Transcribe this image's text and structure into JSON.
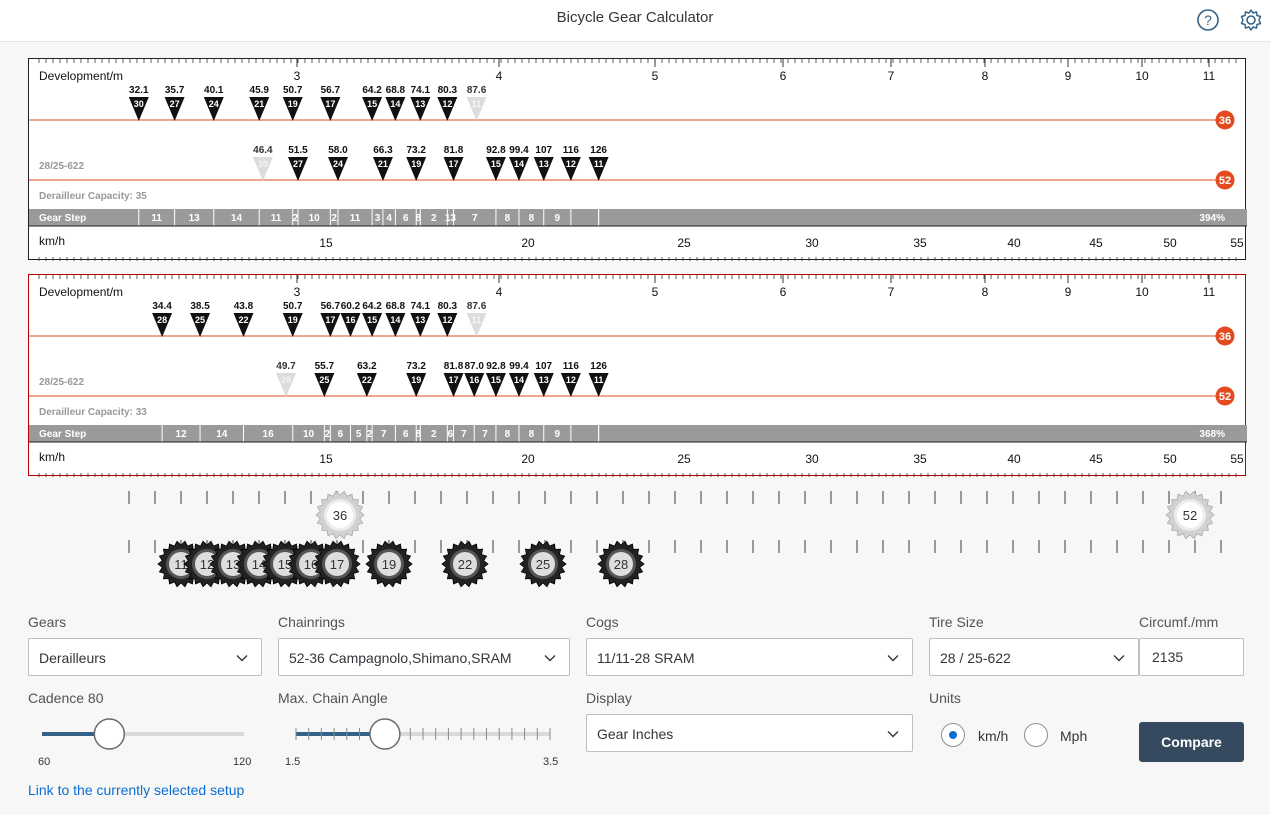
{
  "app": {
    "title": "Bicycle Gear Calculator"
  },
  "header": {
    "help_icon": "help-icon",
    "settings_icon": "gear-settings-icon"
  },
  "panels": [
    {
      "dev_label": "Development/m",
      "dev_ticks": [
        "3",
        "4",
        "5",
        "6",
        "7",
        "8",
        "9",
        "10",
        "11"
      ],
      "tire_label": "28/25-622",
      "capacity_label": "Derailleur Capacity: 35",
      "gear_step_label": "Gear Step",
      "kmh_label": "km/h",
      "speed_ticks": [
        "15",
        "20",
        "25",
        "30",
        "35",
        "40",
        "45",
        "50",
        "55"
      ],
      "chainrings": [
        {
          "teeth": "36",
          "color": "#e34a1d",
          "gears": [
            {
              "value": "32.1",
              "cog": "30",
              "active": true
            },
            {
              "value": "35.7",
              "cog": "27",
              "active": true
            },
            {
              "value": "40.1",
              "cog": "24",
              "active": true
            },
            {
              "value": "45.9",
              "cog": "21",
              "active": true
            },
            {
              "value": "50.7",
              "cog": "19",
              "active": true
            },
            {
              "value": "56.7",
              "cog": "17",
              "active": true
            },
            {
              "value": "64.2",
              "cog": "15",
              "active": true
            },
            {
              "value": "68.8",
              "cog": "14",
              "active": true
            },
            {
              "value": "74.1",
              "cog": "13",
              "active": true
            },
            {
              "value": "80.3",
              "cog": "12",
              "active": true
            },
            {
              "value": "87.6",
              "cog": "11",
              "active": false
            }
          ]
        },
        {
          "teeth": "52",
          "color": "#e34a1d",
          "gears": [
            {
              "value": "46.4",
              "cog": "30",
              "active": false
            },
            {
              "value": "51.5",
              "cog": "27",
              "active": true
            },
            {
              "value": "58.0",
              "cog": "24",
              "active": true
            },
            {
              "value": "66.3",
              "cog": "21",
              "active": true
            },
            {
              "value": "73.2",
              "cog": "19",
              "active": true
            },
            {
              "value": "81.8",
              "cog": "17",
              "active": true
            },
            {
              "value": "92.8",
              "cog": "15",
              "active": true
            },
            {
              "value": "99.4",
              "cog": "14",
              "active": true
            },
            {
              "value": "107",
              "cog": "13",
              "active": true
            },
            {
              "value": "116",
              "cog": "12",
              "active": true
            },
            {
              "value": "126",
              "cog": "11",
              "active": true
            }
          ]
        }
      ],
      "gear_steps": [
        "11",
        "13",
        "14",
        "11",
        "2",
        "10",
        "2",
        "11",
        "3",
        "4",
        "6",
        "8",
        "2",
        "13",
        "7",
        "8",
        "8",
        "9"
      ],
      "total_range": "394%"
    },
    {
      "dev_label": "Development/m",
      "dev_ticks": [
        "3",
        "4",
        "5",
        "6",
        "7",
        "8",
        "9",
        "10",
        "11"
      ],
      "tire_label": "28/25-622",
      "capacity_label": "Derailleur Capacity: 33",
      "gear_step_label": "Gear Step",
      "kmh_label": "km/h",
      "speed_ticks": [
        "15",
        "20",
        "25",
        "30",
        "35",
        "40",
        "45",
        "50",
        "55"
      ],
      "chainrings": [
        {
          "teeth": "36",
          "color": "#e34a1d",
          "gears": [
            {
              "value": "34.4",
              "cog": "28",
              "active": true
            },
            {
              "value": "38.5",
              "cog": "25",
              "active": true
            },
            {
              "value": "43.8",
              "cog": "22",
              "active": true
            },
            {
              "value": "50.7",
              "cog": "19",
              "active": true
            },
            {
              "value": "56.7",
              "cog": "17",
              "active": true
            },
            {
              "value": "60.2",
              "cog": "16",
              "active": true
            },
            {
              "value": "64.2",
              "cog": "15",
              "active": true
            },
            {
              "value": "68.8",
              "cog": "14",
              "active": true
            },
            {
              "value": "74.1",
              "cog": "13",
              "active": true
            },
            {
              "value": "80.3",
              "cog": "12",
              "active": true
            },
            {
              "value": "87.6",
              "cog": "11",
              "active": false
            }
          ]
        },
        {
          "teeth": "52",
          "color": "#e34a1d",
          "gears": [
            {
              "value": "49.7",
              "cog": "28",
              "active": false
            },
            {
              "value": "55.7",
              "cog": "25",
              "active": true
            },
            {
              "value": "63.2",
              "cog": "22",
              "active": true
            },
            {
              "value": "73.2",
              "cog": "19",
              "active": true
            },
            {
              "value": "81.8",
              "cog": "17",
              "active": true
            },
            {
              "value": "87.0",
              "cog": "16",
              "active": true
            },
            {
              "value": "92.8",
              "cog": "15",
              "active": true
            },
            {
              "value": "99.4",
              "cog": "14",
              "active": true
            },
            {
              "value": "107",
              "cog": "13",
              "active": true
            },
            {
              "value": "116",
              "cog": "12",
              "active": true
            },
            {
              "value": "126",
              "cog": "11",
              "active": true
            }
          ]
        }
      ],
      "gear_steps": [
        "12",
        "14",
        "16",
        "10",
        "2",
        "6",
        "5",
        "2",
        "7",
        "6",
        "8",
        "2",
        "6",
        "7",
        "7",
        "8",
        "8",
        "9"
      ],
      "total_range": "368%"
    }
  ],
  "gear_strip": {
    "chainrings": [
      "36",
      "52"
    ],
    "cogs": [
      "11",
      "12",
      "13",
      "14",
      "15",
      "16",
      "17",
      "19",
      "22",
      "25",
      "28"
    ]
  },
  "form": {
    "gears": {
      "label": "Gears",
      "value": "Derailleurs"
    },
    "chainrings": {
      "label": "Chainrings",
      "value": "52-36 Campagnolo,Shimano,SRAM"
    },
    "cogs": {
      "label": "Cogs",
      "value": "11/11-28 SRAM"
    },
    "tire": {
      "label": "Tire Size",
      "value": "28 / 25-622"
    },
    "circumf": {
      "label": "Circumf./mm",
      "value": "2135"
    },
    "cadence": {
      "label": "Cadence 80",
      "min": "60",
      "max": "120",
      "value": 80,
      "min_value": 60,
      "max_value": 120
    },
    "chain_angle": {
      "label": "Max. Chain Angle",
      "min": "1.5",
      "max": "3.5",
      "value": 2.2,
      "min_value": 1.5,
      "max_value": 3.5
    },
    "display": {
      "label": "Display",
      "value": "Gear Inches"
    },
    "units": {
      "label": "Units",
      "options": [
        "km/h",
        "Mph"
      ],
      "selected": "km/h"
    },
    "compare_label": "Compare",
    "link_text": "Link to the currently selected setup"
  },
  "colors": {
    "accent": "#0a6ed1",
    "ring": "#e34a1d",
    "button": "#354a5f",
    "step_bar": "#9a9a9a"
  }
}
